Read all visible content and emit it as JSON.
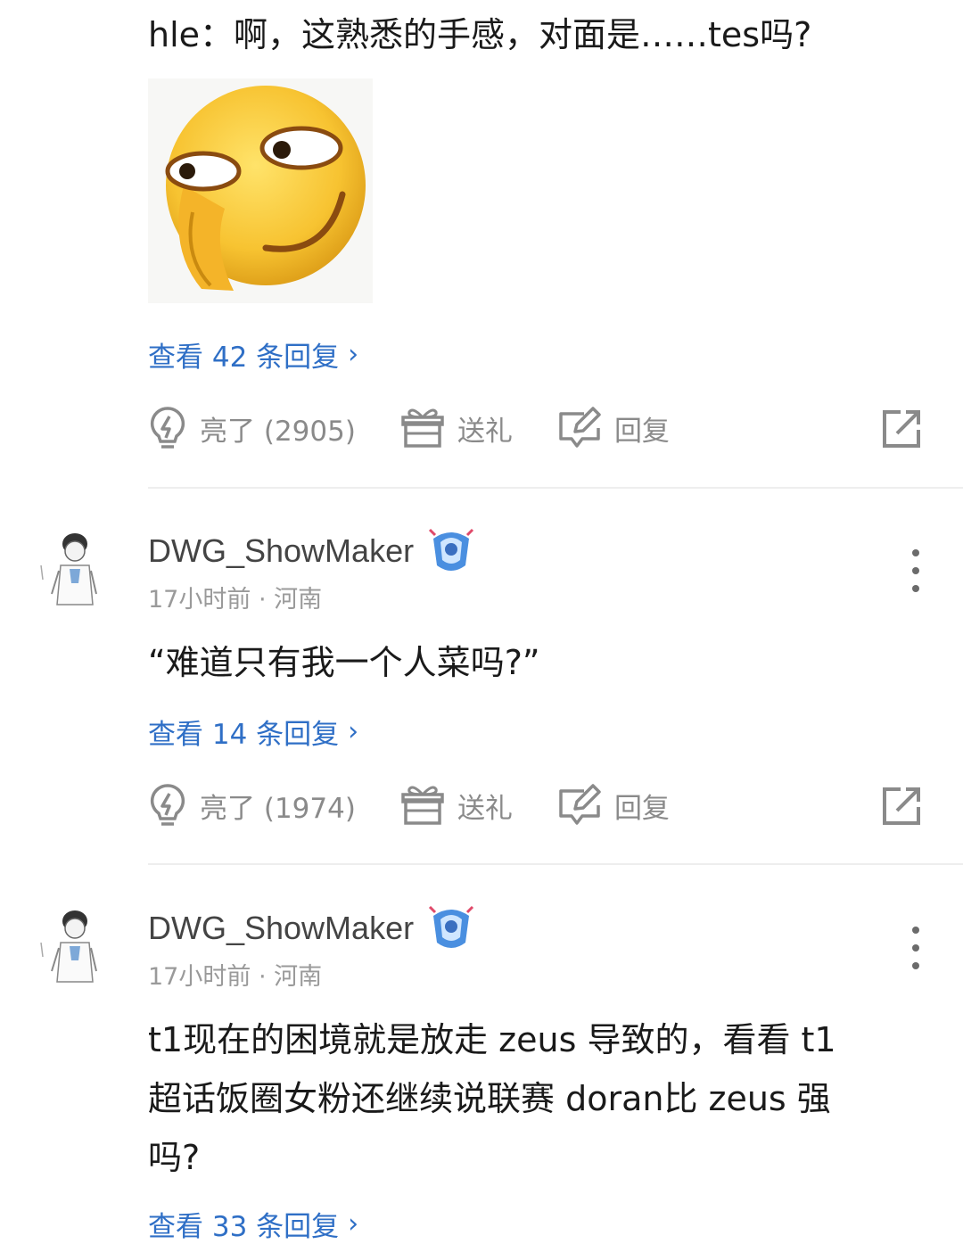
{
  "comments": [
    {
      "text": "hle：啊，这熟悉的手感，对面是……tes吗?",
      "reply_link": "查看 42 条回复",
      "actions": {
        "like": "亮了 (2905)",
        "gift": "送礼",
        "reply": "回复"
      }
    },
    {
      "username": "DWG_ShowMaker",
      "meta": "17小时前 · 河南",
      "text": "“难道只有我一个人菜吗?”",
      "reply_link": "查看 14 条回复",
      "actions": {
        "like": "亮了 (1974)",
        "gift": "送礼",
        "reply": "回复"
      }
    },
    {
      "username": "DWG_ShowMaker",
      "meta": "17小时前 · 河南",
      "text_lines": [
        "t1现在的困境就是放走 zeus 导致的，看看 t1",
        "超话饭圈女粉还继续说联赛 doran比 zeus 强",
        "吗?"
      ],
      "reply_link": "查看 33 条回复"
    }
  ],
  "colors": {
    "link": "#2f6fc6",
    "muted": "#8a8a8a",
    "divider": "#eeeeee"
  },
  "icons": [
    "lightbulb-icon",
    "gift-icon",
    "edit-reply-icon",
    "share-icon",
    "more-vertical-icon",
    "chevron-right-icon",
    "badge-icon",
    "emoji-sticker"
  ]
}
